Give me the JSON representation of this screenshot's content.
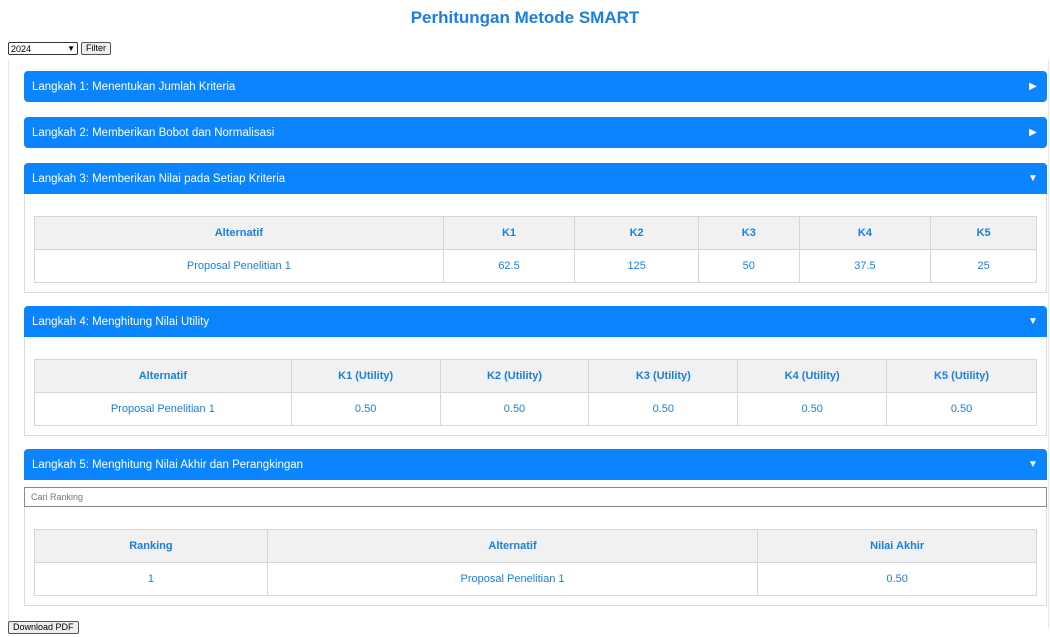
{
  "page": {
    "title": "Perhitungan Metode SMART"
  },
  "filter": {
    "year": "2024",
    "button_label": "Filter"
  },
  "steps": [
    {
      "label": "Langkah 1: Menentukan Jumlah Kriteria",
      "expanded": false,
      "arrow": "▶"
    },
    {
      "label": "Langkah 2: Memberikan Bobot dan Normalisasi",
      "expanded": false,
      "arrow": "▶"
    },
    {
      "label": "Langkah 3: Memberikan Nilai pada Setiap Kriteria",
      "expanded": true,
      "arrow": "▼"
    },
    {
      "label": "Langkah 4: Menghitung Nilai Utility",
      "expanded": true,
      "arrow": "▼"
    },
    {
      "label": "Langkah 5: Menghitung Nilai Akhir dan Perangkingan",
      "expanded": true,
      "arrow": "▼"
    }
  ],
  "step3_table": {
    "headers": [
      "Alternatif",
      "K1",
      "K2",
      "K3",
      "K4",
      "K5"
    ],
    "row": [
      "Proposal Penelitian 1",
      "62.5",
      "125",
      "50",
      "37.5",
      "25"
    ]
  },
  "step4_table": {
    "headers": [
      "Alternatif",
      "K1 (Utility)",
      "K2 (Utility)",
      "K3 (Utility)",
      "K4 (Utility)",
      "K5 (Utility)"
    ],
    "row": [
      "Proposal Penelitian 1",
      "0.50",
      "0.50",
      "0.50",
      "0.50",
      "0.50"
    ]
  },
  "step5": {
    "search_placeholder": "Cari Ranking",
    "headers": [
      "Ranking",
      "Alternatif",
      "Nilai Akhir"
    ],
    "row": [
      "1",
      "Proposal Penelitian 1",
      "0.50"
    ]
  },
  "download_label": "Download PDF",
  "colors": {
    "accent": "#0a84ff",
    "text_accent": "#1a7fe0",
    "header_bg": "#f1f1f1"
  }
}
